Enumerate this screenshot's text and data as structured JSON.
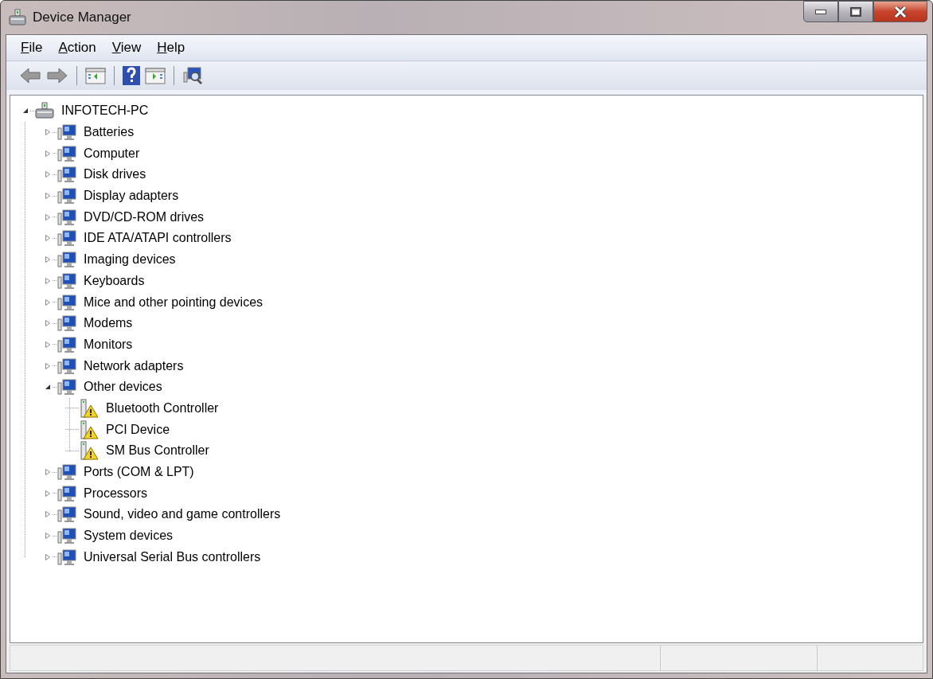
{
  "window": {
    "title": "Device Manager"
  },
  "menu": [
    "File",
    "Action",
    "View",
    "Help"
  ],
  "tree": {
    "label": "INFOTECH-PC",
    "expanded": true,
    "children": [
      {
        "label": "Batteries",
        "expanded": false
      },
      {
        "label": "Computer",
        "expanded": false
      },
      {
        "label": "Disk drives",
        "expanded": false
      },
      {
        "label": "Display adapters",
        "expanded": false
      },
      {
        "label": "DVD/CD-ROM drives",
        "expanded": false
      },
      {
        "label": "IDE ATA/ATAPI controllers",
        "expanded": false
      },
      {
        "label": "Imaging devices",
        "expanded": false
      },
      {
        "label": "Keyboards",
        "expanded": false
      },
      {
        "label": "Mice and other pointing devices",
        "expanded": false
      },
      {
        "label": "Modems",
        "expanded": false
      },
      {
        "label": "Monitors",
        "expanded": false
      },
      {
        "label": "Network adapters",
        "expanded": false
      },
      {
        "label": "Other devices",
        "expanded": true,
        "children": [
          {
            "label": "Bluetooth Controller",
            "warning": true
          },
          {
            "label": "PCI Device",
            "warning": true
          },
          {
            "label": "SM Bus Controller",
            "warning": true
          }
        ]
      },
      {
        "label": "Ports (COM & LPT)",
        "expanded": false
      },
      {
        "label": "Processors",
        "expanded": false
      },
      {
        "label": "Sound, video and game controllers",
        "expanded": false
      },
      {
        "label": "System devices",
        "expanded": false
      },
      {
        "label": "Universal Serial Bus controllers",
        "expanded": false
      }
    ]
  }
}
